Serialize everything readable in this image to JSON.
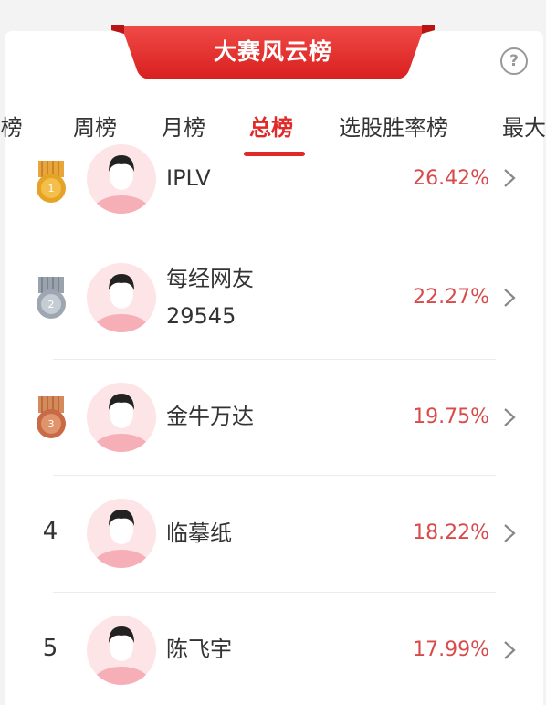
{
  "banner": {
    "title": "大赛风云榜"
  },
  "help": {
    "icon": "question-circle-icon",
    "glyph": "?"
  },
  "tabs": [
    {
      "label": "l榜",
      "active": false
    },
    {
      "label": "周榜",
      "active": false
    },
    {
      "label": "月榜",
      "active": false
    },
    {
      "label": "总榜",
      "active": true
    },
    {
      "label": "选股胜率榜",
      "active": false
    },
    {
      "label": "最大",
      "active": false
    }
  ],
  "rankings": [
    {
      "rank": "1",
      "badge": "gold-medal-icon",
      "name_lines": [
        "IPLV"
      ],
      "percent": "26.42%"
    },
    {
      "rank": "2",
      "badge": "silver-medal-icon",
      "name_lines": [
        "每经网友",
        "29545"
      ],
      "percent": "22.27%"
    },
    {
      "rank": "3",
      "badge": "bronze-medal-icon",
      "name_lines": [
        "金牛万达"
      ],
      "percent": "19.75%"
    },
    {
      "rank": "4",
      "badge": "",
      "name_lines": [
        "临摹纸"
      ],
      "percent": "18.22%"
    },
    {
      "rank": "5",
      "badge": "",
      "name_lines": [
        "陈飞宇"
      ],
      "percent": "17.99%"
    }
  ],
  "colors": {
    "accent": "#e02a2a",
    "percent": "#d94a4a",
    "avatar_bg": "#fde4e6"
  }
}
